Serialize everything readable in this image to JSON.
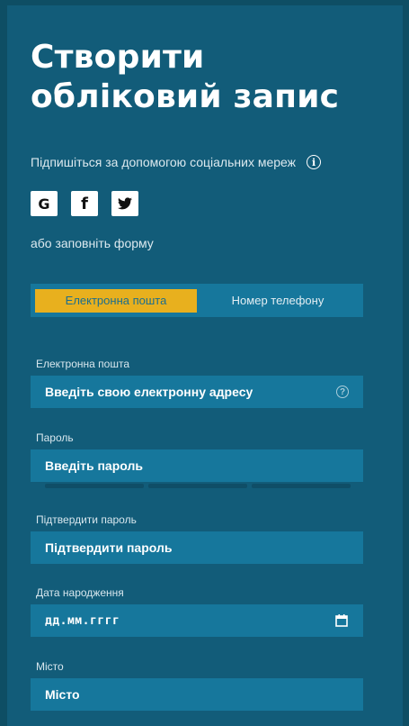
{
  "header": {
    "title_line1": "Створити",
    "title_line2": "обліковий запис"
  },
  "social": {
    "subtitle": "Підпишіться за допомогою соціальних мереж",
    "info_icon": "info-icon",
    "buttons": [
      {
        "name": "google",
        "icon": "google-icon",
        "glyph": "G"
      },
      {
        "name": "facebook",
        "icon": "facebook-icon",
        "glyph": "f"
      },
      {
        "name": "twitter",
        "icon": "twitter-icon"
      }
    ],
    "or_text": "або заповніть форму"
  },
  "tabs": [
    {
      "label": "Електронна пошта",
      "active": true
    },
    {
      "label": "Номер телефону",
      "active": false
    }
  ],
  "form": {
    "email": {
      "label": "Електронна пошта",
      "placeholder": "Введіть свою електронну адресу",
      "help_glyph": "?"
    },
    "password": {
      "label": "Пароль",
      "placeholder": "Введіть пароль"
    },
    "confirm": {
      "label": "Підтвердити пароль",
      "placeholder": "Підтвердити пароль"
    },
    "birthdate": {
      "label": "Дата народження",
      "placeholder": "дд.мм.гггг"
    },
    "city": {
      "label": "Місто",
      "placeholder": "Місто"
    }
  },
  "colors": {
    "background": "#0e4e64",
    "panel": "#125c79",
    "field": "#16779c",
    "accent": "#e8b01e",
    "active_tab_text": "#1b6e8f"
  }
}
